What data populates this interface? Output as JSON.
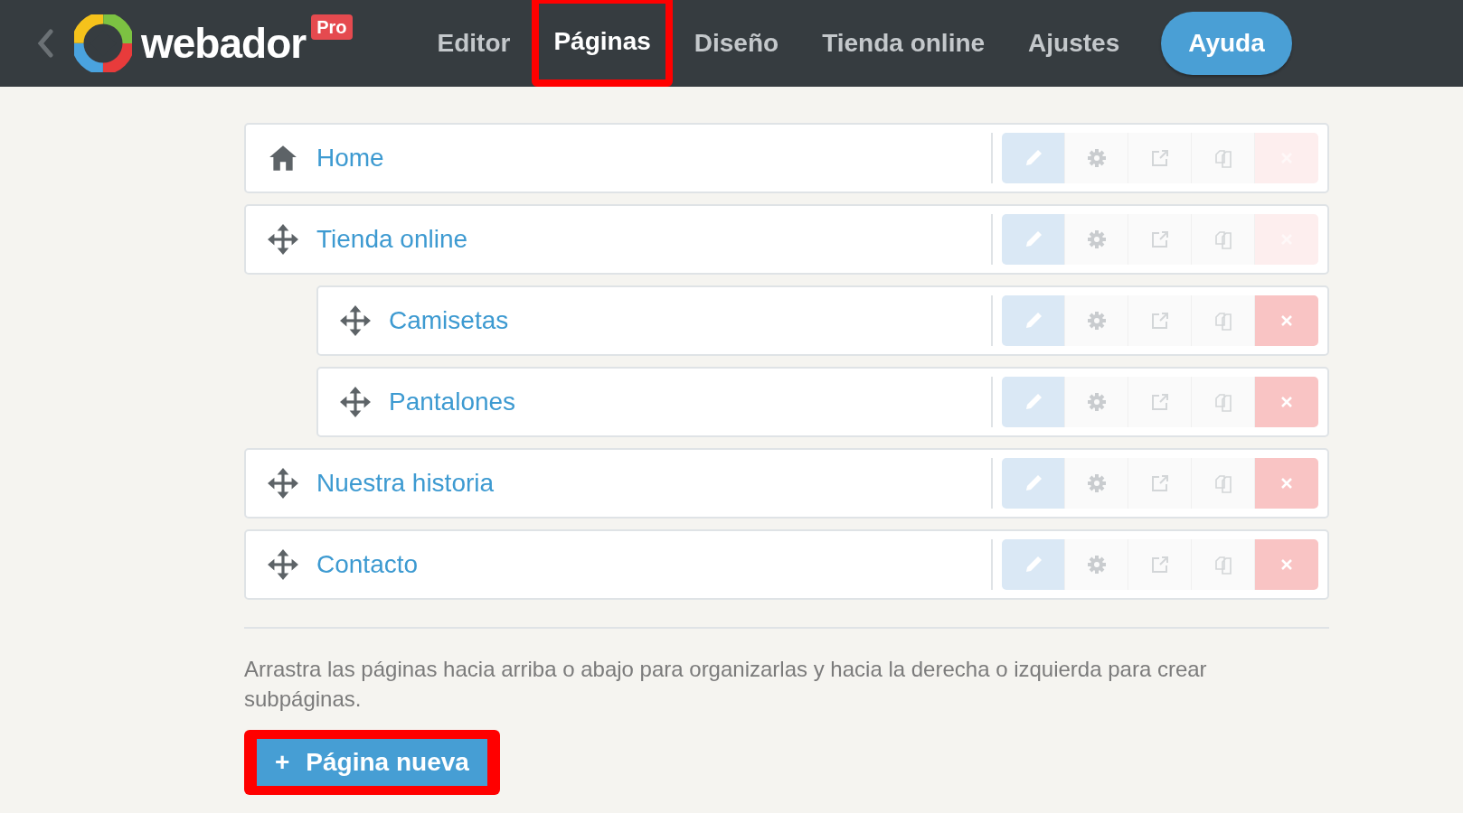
{
  "header": {
    "logo_text": "webador",
    "plan_badge": "Pro",
    "nav": [
      {
        "label": "Editor",
        "selected": false,
        "highlighted": false
      },
      {
        "label": "Páginas",
        "selected": true,
        "highlighted": true
      },
      {
        "label": "Diseño",
        "selected": false,
        "highlighted": false
      },
      {
        "label": "Tienda online",
        "selected": false,
        "highlighted": false
      },
      {
        "label": "Ajustes",
        "selected": false,
        "highlighted": false
      }
    ],
    "help_button": "Ayuda"
  },
  "pages": [
    {
      "title": "Home",
      "kind": "home",
      "delete_disabled": true
    },
    {
      "title": "Tienda online",
      "kind": "page",
      "delete_disabled": true,
      "children": [
        {
          "title": "Camisetas",
          "kind": "page",
          "delete_disabled": false
        },
        {
          "title": "Pantalones",
          "kind": "page",
          "delete_disabled": false
        }
      ]
    },
    {
      "title": "Nuestra historia",
      "kind": "page",
      "delete_disabled": false
    },
    {
      "title": "Contacto",
      "kind": "page",
      "delete_disabled": false
    }
  ],
  "hint": "Arrastra las páginas hacia arriba o abajo para organizarlas y hacia la derecha o izquierda para crear subpáginas.",
  "new_page_button": {
    "icon": "+",
    "label": "Página nueva",
    "highlighted": true
  }
}
